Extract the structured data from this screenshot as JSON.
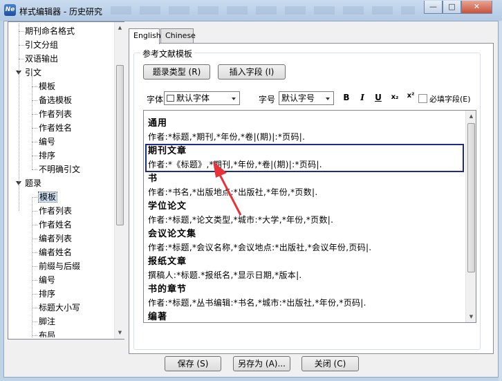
{
  "window": {
    "title": "样式编辑器 - 历史研究",
    "controls": {
      "minimize": "—",
      "maximize": "□",
      "close": "✕"
    }
  },
  "tree": {
    "items": [
      {
        "label": "期刊命名格式",
        "level": 1
      },
      {
        "label": "引文分组",
        "level": 1
      },
      {
        "label": "双语输出",
        "level": 1
      },
      {
        "label": "引文",
        "level": 0,
        "expanded": true
      },
      {
        "label": "模板",
        "level": 2
      },
      {
        "label": "备选模板",
        "level": 2
      },
      {
        "label": "作者列表",
        "level": 2
      },
      {
        "label": "作者姓名",
        "level": 2
      },
      {
        "label": "编号",
        "level": 2
      },
      {
        "label": "排序",
        "level": 2
      },
      {
        "label": "不明确引文",
        "level": 2
      },
      {
        "label": "题录",
        "level": 0,
        "expanded": true
      },
      {
        "label": "模板",
        "level": 2,
        "selected": true
      },
      {
        "label": "作者列表",
        "level": 2
      },
      {
        "label": "作者姓名",
        "level": 2
      },
      {
        "label": "编者列表",
        "level": 2
      },
      {
        "label": "编者姓名",
        "level": 2
      },
      {
        "label": "前缀与后缀",
        "level": 2
      },
      {
        "label": "编号",
        "level": 2
      },
      {
        "label": "排序",
        "level": 2
      },
      {
        "label": "标题大小写",
        "level": 2
      },
      {
        "label": "脚注",
        "level": 2
      },
      {
        "label": "布局",
        "level": 2
      }
    ]
  },
  "tabs": [
    {
      "label": "English",
      "active": true
    },
    {
      "label": "Chinese",
      "active": false
    }
  ],
  "group": {
    "label": "参考文献模板",
    "ref_type_button": "题录类型 (R)",
    "insert_field_button": "插入字段 (I)",
    "font_label": "字体",
    "font_value": "默认字体",
    "size_label": "字号",
    "size_value": "默认字号",
    "bold": "B",
    "italic": "I",
    "underline": "U",
    "subscript": "x₂",
    "superscript": "x²",
    "required_field": "必填字段(E)"
  },
  "templates": [
    {
      "name": "通用",
      "format": "作者:*标题,*期刊,*年份,*卷|(期)|:*页码|."
    },
    {
      "name": "期刊文章",
      "format": "作者:*《标题》,*期刊,*年份,*卷|(期)|:*页码|.",
      "selected": true
    },
    {
      "name": "书",
      "format": "作者:*书名,*出版地点:*出版社,*年份,*页数|."
    },
    {
      "name": "学位论文",
      "format": "作者:*标题,*论文类型,*城市:*大学,*年份,*页数|."
    },
    {
      "name": "会议论文集",
      "format": "作者:*标题,*会议名称,*会议地点:*出版社,*会议年份,页码|."
    },
    {
      "name": "报纸文章",
      "format": "撰稿人:*标题.*报纸名,*显示日期,*版本|."
    },
    {
      "name": "书的章节",
      "format": "作者:*标题,*丛书编辑:*书名,*城市:*出版社,*年份,*页码|."
    },
    {
      "name": "编著",
      "format": ""
    }
  ],
  "footer": {
    "save": "保存 (S)",
    "save_as": "另存为 (A)...",
    "close": "关闭 (C)"
  },
  "colors": {
    "selection_border": "#1d2c8c",
    "annotation_arrow": "#e8323a",
    "tree_selection": "#cde3f7"
  }
}
